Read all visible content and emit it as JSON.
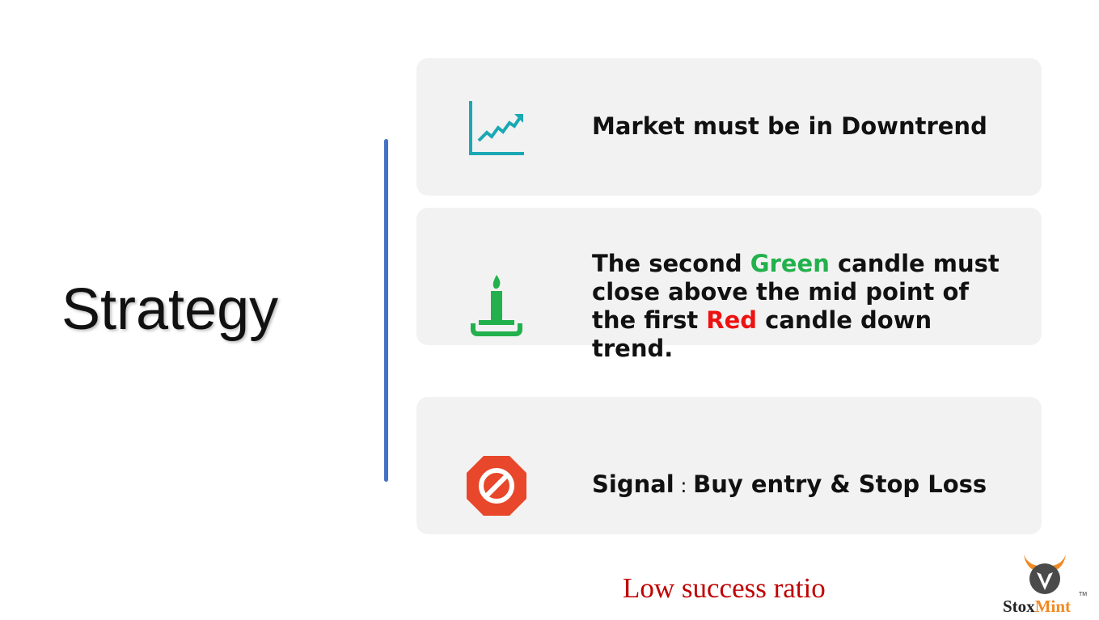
{
  "slide": {
    "title": "Strategy",
    "accent_divider_color": "#4472c4",
    "card_background": "#f2f2f2"
  },
  "cards": [
    {
      "icon": "trend-chart-icon",
      "icon_color": "#1aa8b4",
      "text": "Market must be in  Downtrend"
    },
    {
      "icon": "candle-icon",
      "icon_color": "#22b14c",
      "text_parts": {
        "a": "The second ",
        "green_word": "Green",
        "b": " candle must",
        "c": "close above the mid point of",
        "d": "the first ",
        "red_word": "Red",
        "e": " candle down",
        "f": "trend."
      },
      "green_color": "#22b14c",
      "red_color": "#ee1111"
    },
    {
      "icon": "stop-sign-icon",
      "icon_color": "#e8472b",
      "label": "Signal",
      "separator": ":",
      "text": "Buy entry & Stop Loss"
    }
  ],
  "footer": {
    "note": "Low success ratio",
    "note_color": "#c00000"
  },
  "logo": {
    "name_part1": "Stox",
    "name_part2": "Mint",
    "trademark": "TM",
    "accent_color": "#f08a24"
  }
}
